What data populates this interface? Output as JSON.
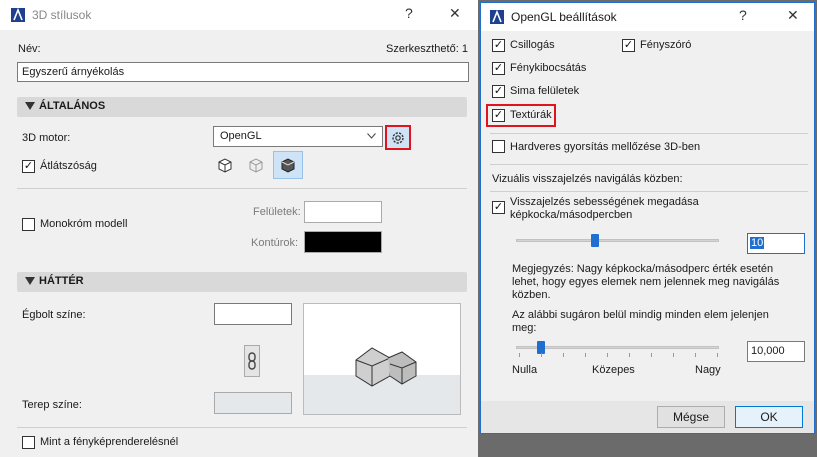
{
  "left_window": {
    "title": "3D stílusok",
    "help_glyph": "?",
    "close_glyph": "✕",
    "name_label": "Név:",
    "editable_label": "Szerkeszthető: 1",
    "name_value": "Egyszerű árnyékolás",
    "general_section": "ÁLTALÁNOS",
    "engine_label": "3D motor:",
    "engine_value": "OpenGL",
    "transparency_label": "Átlátszóság",
    "mono_label": "Monokróm modell",
    "surfaces_label": "Felületek:",
    "contours_label": "Kontúrok:",
    "background_section": "HÁTTÉR",
    "sky_label": "Égbolt színe:",
    "ground_label": "Terep színe:",
    "photo_label": "Mint a fényképrenderelésnél"
  },
  "right_window": {
    "title": "OpenGL beállítások",
    "help_glyph": "?",
    "close_glyph": "✕",
    "shiny_label": "Csillogás",
    "spotlight_label": "Fényszóró",
    "light_leak_label": "Fénykibocsátás",
    "smooth_label": "Sima felületek",
    "textures_label": "Textúrák",
    "hw_label": "Hardveres gyorsítás mellőzése 3D-ben",
    "nav_heading": "Vizuális visszajelzés navigálás közben:",
    "speed_label_line1": "Visszajelzés sebességének megadása",
    "speed_label_line2": "képkocka/másodpercben",
    "fps_value": "10",
    "note_line1": "Megjegyzés: Nagy képkocka/másodperc érték esetén",
    "note_line2": "lehet, hogy egyes elemek nem jelennek meg navigálás",
    "note_line3": "közben.",
    "radius_line1": "Az alábbi sugáron belül mindig minden elem jelenjen",
    "radius_line2": "meg:",
    "radius_value": "10,000",
    "scale_null": "Nulla",
    "scale_mid": "Közepes",
    "scale_high": "Nagy",
    "cancel_label": "Mégse",
    "ok_label": "OK"
  },
  "checkmark": "✓",
  "colors": {
    "accent": "#1e6fd0",
    "highlight_red": "#e0141e",
    "contour_swatch": "#000000"
  }
}
